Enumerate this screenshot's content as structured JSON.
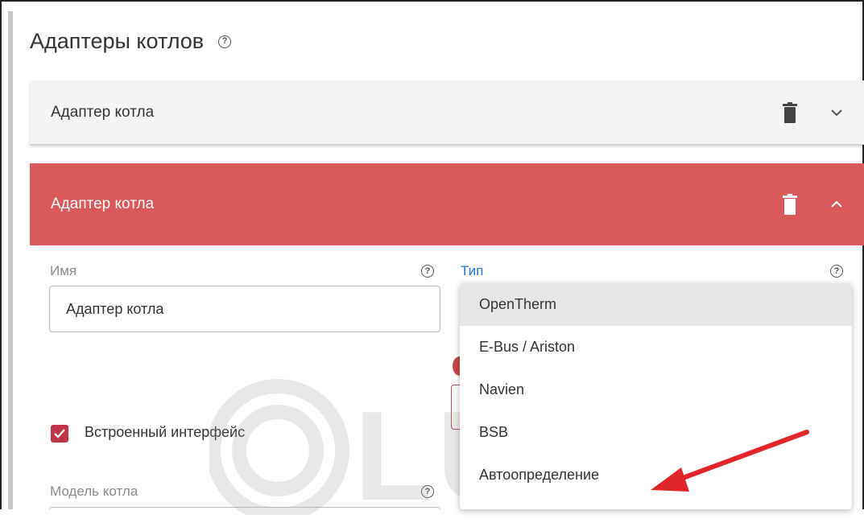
{
  "section": {
    "title": "Адаптеры котлов",
    "help": "?"
  },
  "panels": [
    {
      "title": "Адаптер котла",
      "state": "collapsed"
    },
    {
      "title": "Адаптер котла",
      "state": "expanded"
    }
  ],
  "form": {
    "name_label": "Имя",
    "name_help": "?",
    "name_value": "Адаптер котла",
    "type_label": "Тип",
    "type_help": "?",
    "builtin_interface_label": "Встроенный интерфейс",
    "builtin_interface_checked": true,
    "model_label": "Модель котла",
    "model_help": "?"
  },
  "dropdown": {
    "options": [
      "OpenTherm",
      "E-Bus / Ariston",
      "Navien",
      "BSB",
      "Автоопределение"
    ],
    "highlighted": "OpenTherm"
  },
  "watermark": {
    "text": "LUNDA"
  },
  "colors": {
    "accent_red": "#d95858",
    "checkbox": "#c0344a",
    "link_blue": "#1f78d1",
    "arrow": "#e0262a"
  }
}
